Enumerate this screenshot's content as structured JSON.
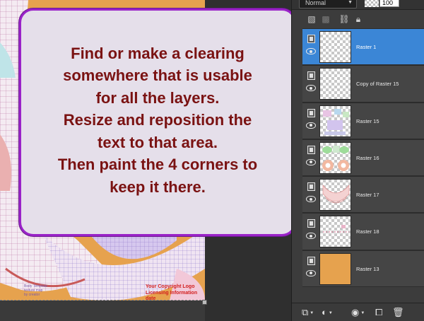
{
  "callout": {
    "lines": [
      "Find or make a clearing",
      "somewhere that is usable",
      "for all the layers.",
      "Resize and reposition the",
      "text to that area.",
      "Then paint the 4 corners to",
      "keep it there."
    ]
  },
  "canvas": {
    "copyright_lines": [
      "Your Copyright Logo",
      "Licensing Information",
      "date"
    ],
    "small_text_lines": [
      "Body Template",
      "texture map",
      "by creator"
    ],
    "colors": {
      "background": "#e6a24e",
      "callout_border": "#9a23c8",
      "callout_text": "#7a1212",
      "note_text": "#d21e1e"
    }
  },
  "layers_panel": {
    "blend_mode": "Normal",
    "opacity": "100",
    "toolbar_icons": [
      "layer-mask-icon",
      "layer-group-icon",
      "link-icon",
      "lock-icon"
    ],
    "layers": [
      {
        "name": "Raster 1",
        "selected": true,
        "thumb": "transparent"
      },
      {
        "name": "Copy of Raster 15",
        "selected": false,
        "thumb": "transparent"
      },
      {
        "name": "Raster 15",
        "selected": false,
        "thumb": "pattern-a"
      },
      {
        "name": "Raster 16",
        "selected": false,
        "thumb": "pattern-b"
      },
      {
        "name": "Raster 17",
        "selected": false,
        "thumb": "pattern-c"
      },
      {
        "name": "Raster 18",
        "selected": false,
        "thumb": "pattern-d"
      },
      {
        "name": "Raster 13",
        "selected": false,
        "thumb": "solid"
      }
    ],
    "footer_icons": [
      "new-layer-icon",
      "adjustment-layer-icon",
      "mask-icon",
      "merge-icon",
      "delete-icon"
    ]
  }
}
